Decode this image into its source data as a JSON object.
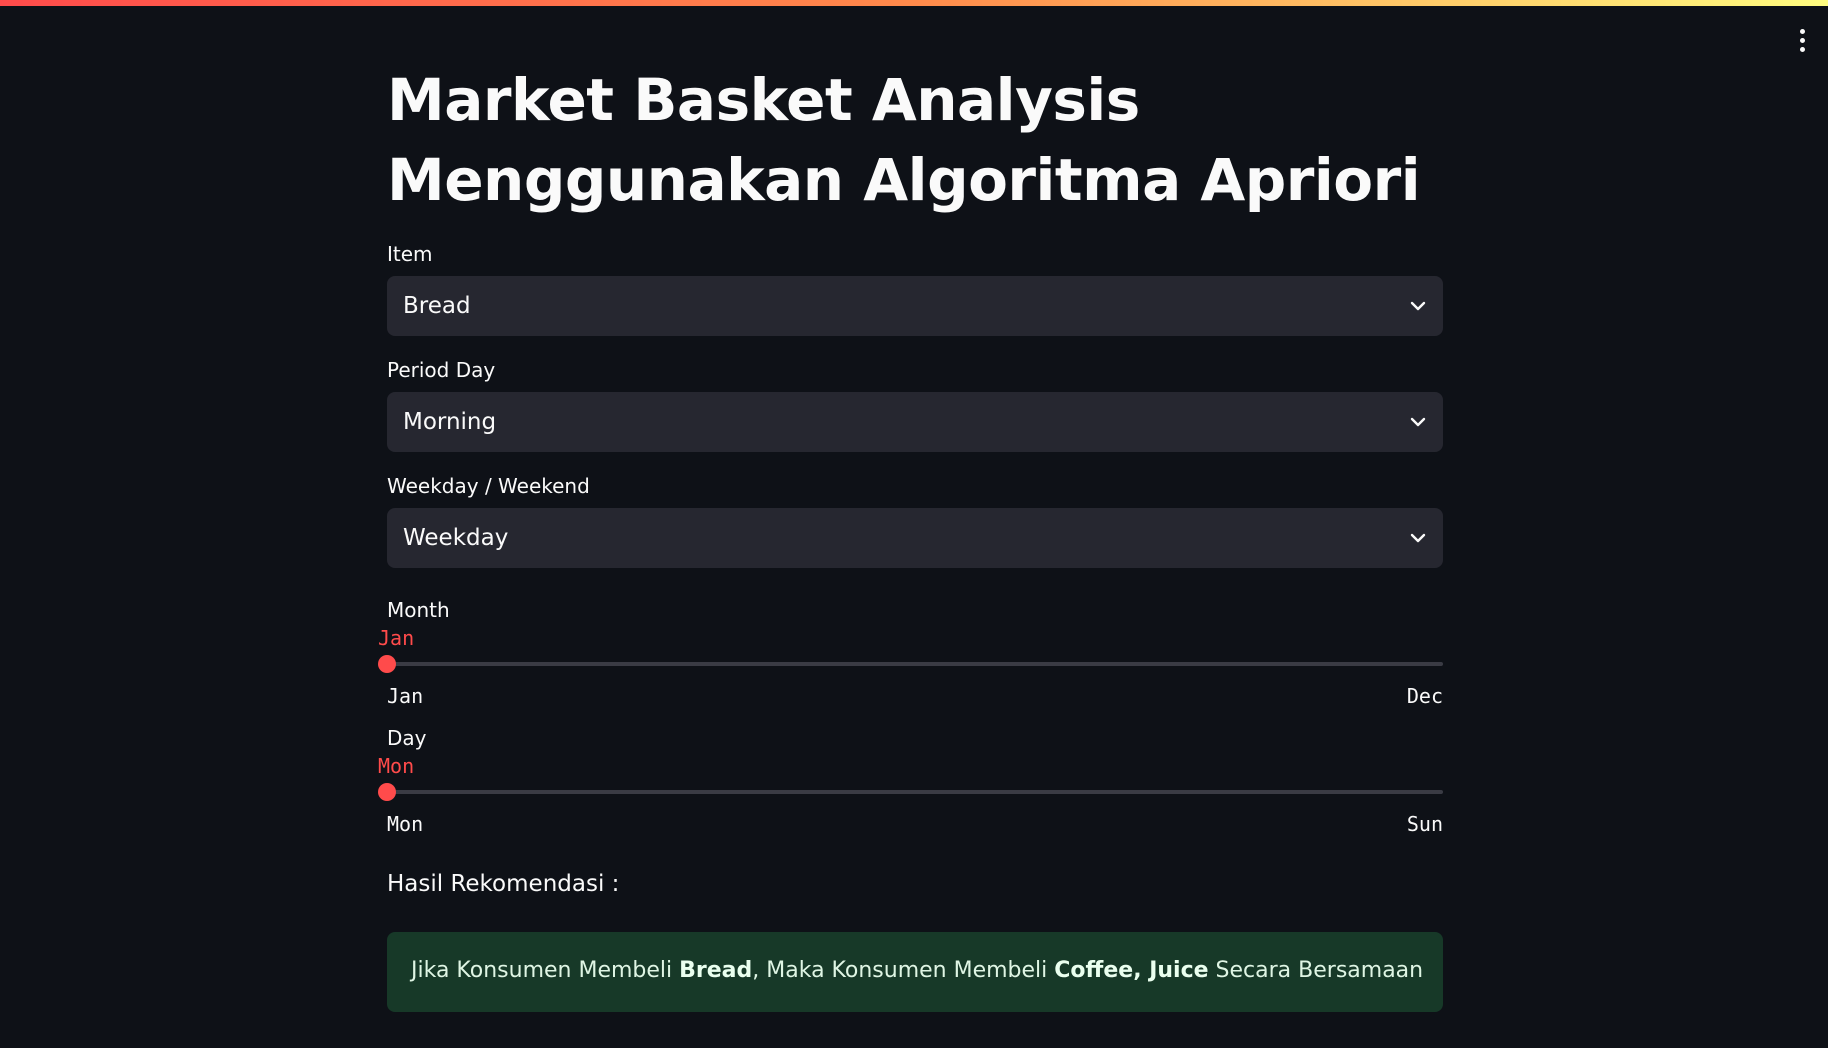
{
  "colors": {
    "background": "#0e1117",
    "select_bg": "#262730",
    "accent": "#ff4b4b",
    "success_bg": "#173928"
  },
  "header": {
    "menu_icon": "kebab-menu-icon"
  },
  "page": {
    "title": "Market Basket Analysis Menggunakan Algoritma Apriori"
  },
  "form": {
    "item": {
      "label": "Item",
      "value": "Bread",
      "icon": "chevron-down-icon"
    },
    "period_day": {
      "label": "Period Day",
      "value": "Morning",
      "icon": "chevron-down-icon"
    },
    "weekday_weekend": {
      "label": "Weekday / Weekend",
      "value": "Weekday",
      "icon": "chevron-down-icon"
    },
    "month": {
      "label": "Month",
      "value": "Jan",
      "min": "Jan",
      "max": "Dec",
      "level": 0
    },
    "day": {
      "label": "Day",
      "value": "Mon",
      "min": "Mon",
      "max": "Sun",
      "level": 0
    }
  },
  "result": {
    "heading": "Hasil Rekomendasi :",
    "prefix": "Jika Konsumen Membeli ",
    "antecedent": "Bread",
    "middle": ", Maka Konsumen Membeli ",
    "consequent": "Coffee, Juice",
    "suffix": " Secara Bersamaan"
  }
}
